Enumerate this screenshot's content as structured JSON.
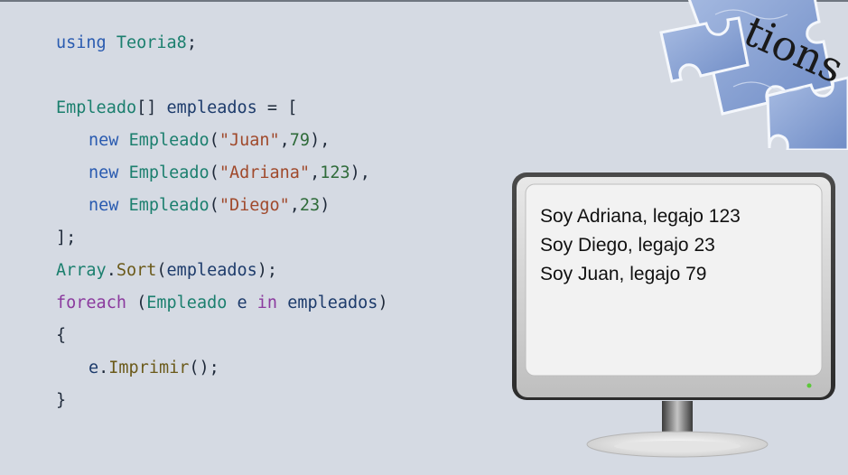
{
  "code": {
    "using_kw": "using",
    "using_ns": "Teoria8",
    "decl_type": "Empleado",
    "decl_var": "empleados",
    "new_kw": "new",
    "ctor": "Empleado",
    "items": [
      {
        "name": "\"Juan\"",
        "num": "79"
      },
      {
        "name": "\"Adriana\"",
        "num": "123"
      },
      {
        "name": "\"Diego\"",
        "num": "23"
      }
    ],
    "close_array": "];",
    "sort_class": "Array",
    "sort_method": "Sort",
    "sort_arg": "empleados",
    "foreach_kw": "foreach",
    "foreach_type": "Empleado",
    "foreach_var": "e",
    "in_kw": "in",
    "foreach_coll": "empleados",
    "open_brace": "{",
    "call_obj": "e",
    "call_method": "Imprimir",
    "close_brace": "}"
  },
  "output": {
    "lines": [
      "Soy Adriana, legajo 123",
      "Soy Diego, legajo 23",
      "Soy Juan, legajo 79"
    ]
  },
  "decoration": {
    "puzzle_text": "tions",
    "puzzle_color": "#8ea6d4"
  },
  "colors": {
    "background": "#d5dae3",
    "monitor_frame": "#3a3a3a",
    "screen": "#f2f2f2",
    "power_led": "#5cc83a"
  }
}
